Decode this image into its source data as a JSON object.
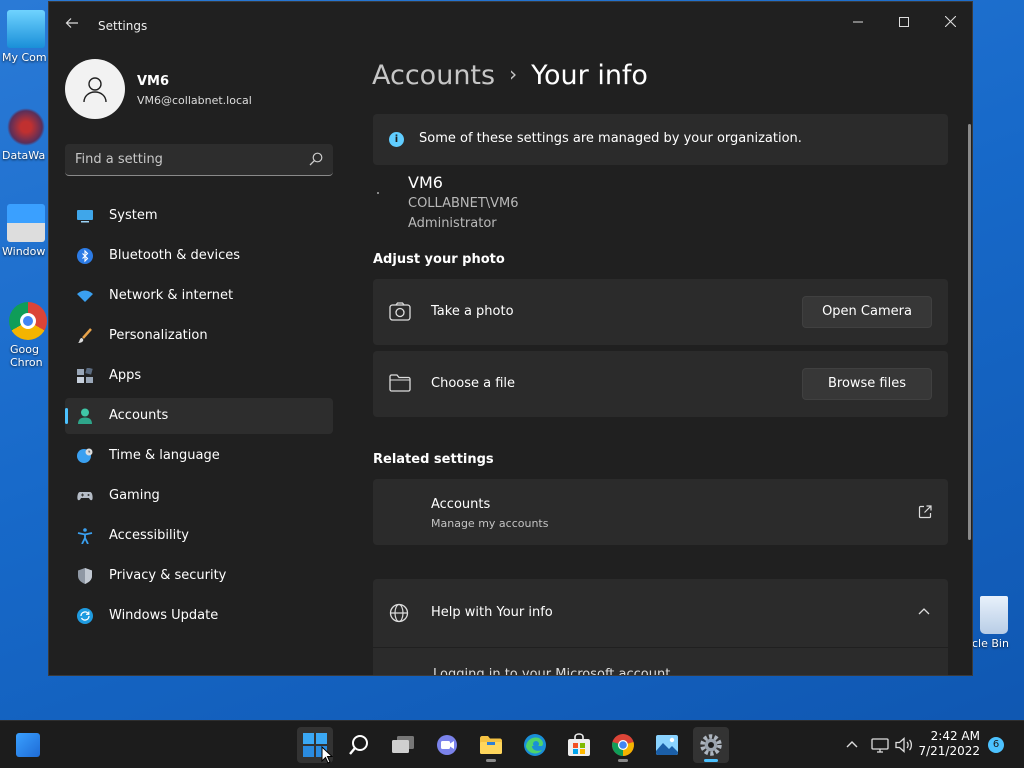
{
  "desktop": {
    "icons": [
      {
        "label": "My Com"
      },
      {
        "label": "DataWa"
      },
      {
        "label": "Window"
      },
      {
        "label": "Goog Chron"
      },
      {
        "label": "cle Bin"
      }
    ]
  },
  "window": {
    "title": "Settings",
    "controls": {
      "minimize": "—",
      "maximize": "☐",
      "close": "✕"
    }
  },
  "profile": {
    "name": "VM6",
    "email": "VM6@collabnet.local"
  },
  "search": {
    "placeholder": "Find a setting"
  },
  "nav": {
    "items": [
      {
        "label": "System",
        "icon": "monitor-icon"
      },
      {
        "label": "Bluetooth & devices",
        "icon": "bluetooth-icon"
      },
      {
        "label": "Network & internet",
        "icon": "wifi-icon"
      },
      {
        "label": "Personalization",
        "icon": "brush-icon"
      },
      {
        "label": "Apps",
        "icon": "apps-icon"
      },
      {
        "label": "Accounts",
        "icon": "person-icon",
        "active": true
      },
      {
        "label": "Time & language",
        "icon": "globe-clock-icon"
      },
      {
        "label": "Gaming",
        "icon": "gamepad-icon"
      },
      {
        "label": "Accessibility",
        "icon": "accessibility-icon"
      },
      {
        "label": "Privacy & security",
        "icon": "shield-icon"
      },
      {
        "label": "Windows Update",
        "icon": "update-icon"
      }
    ]
  },
  "breadcrumb": {
    "parent": "Accounts",
    "separator": "›",
    "current": "Your info"
  },
  "info_bar": {
    "text": "Some of these settings are managed by your organization."
  },
  "user": {
    "name": "VM6",
    "domain_account": "COLLABNET\\VM6",
    "role": "Administrator"
  },
  "adjust_photo": {
    "heading": "Adjust your photo",
    "take_photo": {
      "label": "Take a photo",
      "button": "Open Camera"
    },
    "choose_file": {
      "label": "Choose a file",
      "button": "Browse files"
    }
  },
  "related": {
    "heading": "Related settings",
    "accounts": {
      "title": "Accounts",
      "subtitle": "Manage my accounts"
    }
  },
  "help": {
    "title": "Help with Your info",
    "link": "Logging in to your Microsoft account"
  },
  "taskbar": {
    "clock": {
      "time": "2:42 AM",
      "date": "7/21/2022"
    },
    "notifications": "6"
  },
  "colors": {
    "accent": "#4cc2ff",
    "window_bg": "#202020",
    "card_bg": "#2b2b2b",
    "desktop": "#1769c9"
  }
}
